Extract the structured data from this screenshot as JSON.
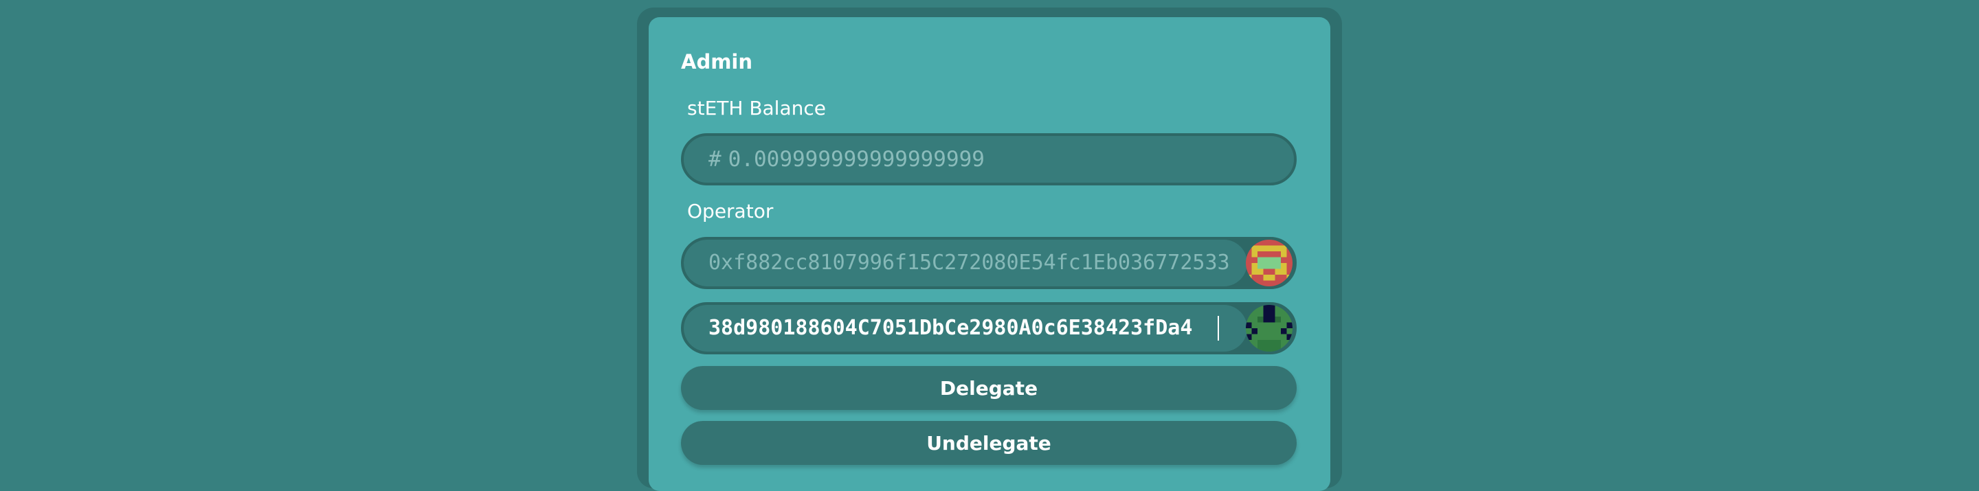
{
  "admin": {
    "title": "Admin",
    "balance": {
      "label": "stETH Balance",
      "hash_symbol": "#",
      "value": "0.009999999999999999"
    },
    "operator": {
      "label": "Operator",
      "current_address": "0xf882cc8107996f15C272080E54fc1Eb036772533",
      "input_value": "38d980188604C7051DbCe2980A0c6E38423fDa4"
    },
    "buttons": {
      "delegate": "Delegate",
      "undelegate": "Undelegate"
    }
  },
  "colors": {
    "page_background": "#37807f",
    "card_background": "#4aabab",
    "field_background": "#377c7b",
    "button_background": "#347473",
    "text": "#ffffff"
  },
  "icons": {
    "operator_avatar": "blockie-avatar-red-yellow",
    "input_avatar": "blockie-avatar-green-navy"
  }
}
